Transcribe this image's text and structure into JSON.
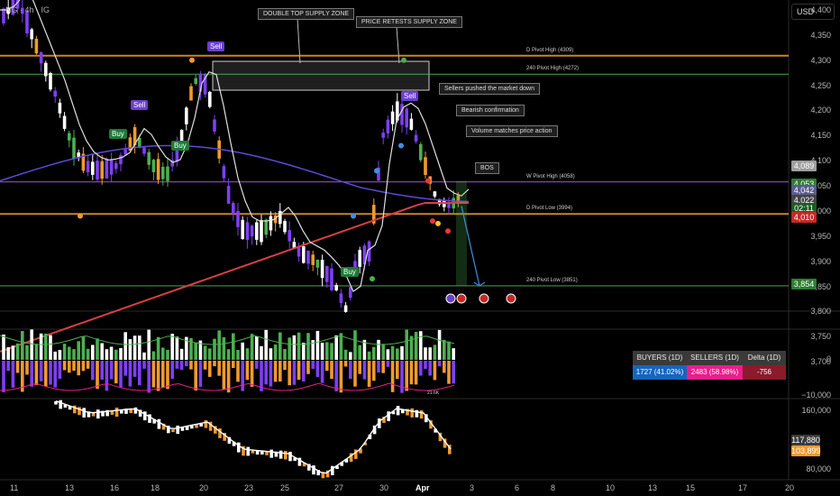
{
  "header": {
    "symbol": "NG",
    "interval": "4h",
    "exchange": "IG",
    "text": "NG · 4h · IG"
  },
  "currency_button": {
    "label": "USD"
  },
  "price_axis": {
    "labels": [
      "4,400",
      "4,350",
      "4,300",
      "4,250",
      "4,200",
      "4,150",
      "4,100",
      "4,050",
      "4,000",
      "3,950",
      "3,900",
      "3,850",
      "3,800",
      "3,750",
      "3,700"
    ],
    "values": [
      4400,
      4350,
      4300,
      4250,
      4200,
      4150,
      4100,
      4050,
      4000,
      3950,
      3900,
      3850,
      3800,
      3750,
      3700
    ]
  },
  "price_tags": [
    {
      "text": "4,089",
      "value": 4089,
      "color": "#9e9e9e"
    },
    {
      "text": "4,053",
      "value": 4053,
      "color": "#2e7d32"
    },
    {
      "text": "4,042",
      "value": 4042,
      "color": "#5b5b8f"
    },
    {
      "text": "4,022",
      "value": 4022,
      "color": "#444444"
    },
    {
      "text": "02:11",
      "value": 4005,
      "color": "#1b5e20"
    },
    {
      "text": "4,010",
      "value": 3987,
      "color": "#c62828"
    },
    {
      "text": "3,854",
      "value": 3854,
      "color": "#2e7d32"
    }
  ],
  "level_lines": [
    {
      "label": "D Pivot High (4309)",
      "value": 4309,
      "color": "#f09a2e"
    },
    {
      "label": "240 Pivot High (4272)",
      "value": 4272,
      "color": "#4caf50"
    },
    {
      "label": "W Pivot High (4058)",
      "value": 4058,
      "color": "#9c4dcc"
    },
    {
      "label": "D Pivot Low (3994)",
      "value": 3994,
      "color": "#f09a2e"
    },
    {
      "label": "240 Pivot Low (3851)",
      "value": 3851,
      "color": "#4caf50"
    }
  ],
  "callouts": {
    "double_top": "DOUBLE TOP SUPPLY ZONE",
    "price_retests": "PRICE RETESTS SUPPLY ZONE",
    "sellers_pushed": "Sellers pushed the market down",
    "bearish_confirmation": "Bearish confirmation",
    "volume_matches": "Volume matches price action",
    "bos": "BOS"
  },
  "signals": [
    {
      "type": "sell",
      "label": "Sell"
    },
    {
      "type": "sell",
      "label": "Sell"
    },
    {
      "type": "sell",
      "label": "Sell"
    },
    {
      "type": "buy",
      "label": "Buy"
    },
    {
      "type": "buy",
      "label": "Buy"
    },
    {
      "type": "buy",
      "label": "Buy"
    }
  ],
  "volume_axis": {
    "zero_label": "0",
    "neg_label": "−10,000"
  },
  "volume_stats": {
    "headers": {
      "buyers": "BUYERS (1D)",
      "sellers": "SELLERS (1D)",
      "delta": "Delta (1D)"
    },
    "values": {
      "buyers": "1727 (41.02%)",
      "sellers": "2483 (58.98%)",
      "delta": "-756"
    },
    "colors": {
      "buyers": "#1565c0",
      "sellers": "#e91e8c",
      "delta": "#8b1a2a"
    }
  },
  "obv_axis": {
    "labels": [
      "160,000",
      "80,000"
    ]
  },
  "obv_tags": [
    {
      "text": "117,880",
      "color": "#3a3a3a"
    },
    {
      "text": "103,899",
      "color": "#f09a2e"
    }
  ],
  "volume_annotation": {
    "text": "21.6K"
  },
  "time_axis": {
    "labels": [
      "11",
      "13",
      "16",
      "18",
      "20",
      "23",
      "25",
      "27",
      "30",
      "Apr",
      "3",
      "6",
      "8",
      "10",
      "13",
      "15",
      "17",
      "20"
    ]
  },
  "theme": {
    "background": "#000000",
    "bull": "#ffffff",
    "bear": "#7e3ff2",
    "sma_red": "#d84040",
    "sma_blue": "#5a4bd8"
  }
}
